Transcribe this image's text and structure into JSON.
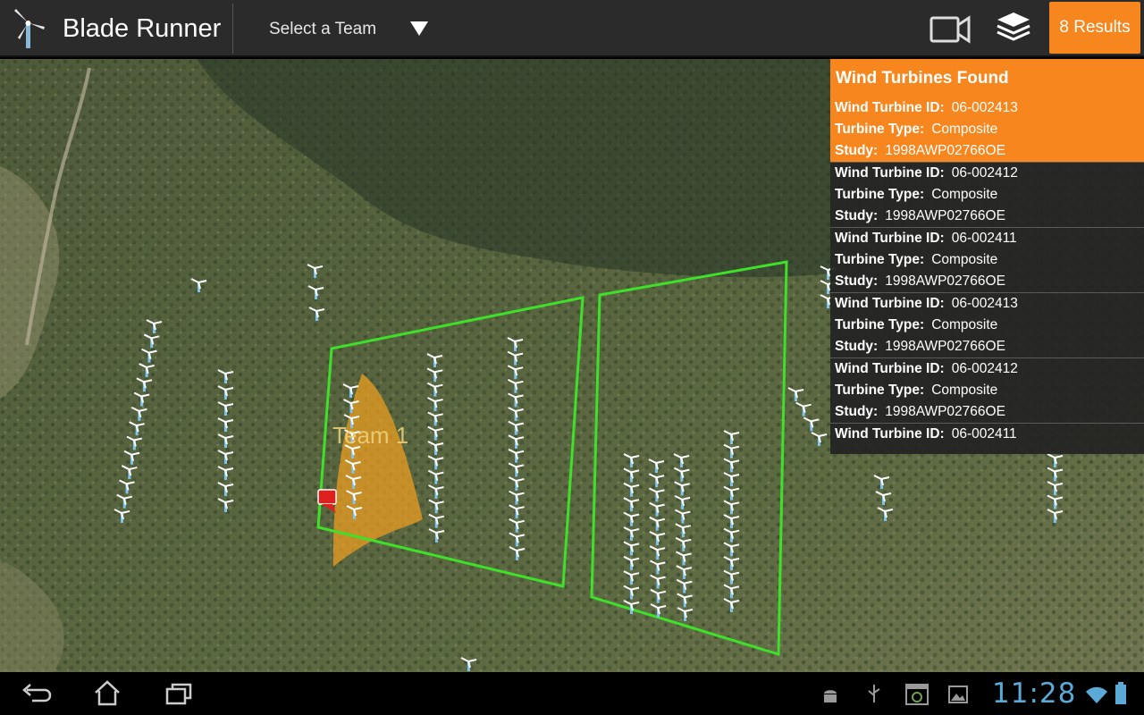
{
  "app": {
    "title": "Blade Runner",
    "icon": "wind-turbine-icon"
  },
  "action_bar": {
    "team_select": {
      "selected": "Select a Team"
    },
    "camera_icon": "video-camera-icon",
    "layers_icon": "layers-icon",
    "results_button": "8 Results"
  },
  "map": {
    "team_label": "Team 1",
    "marker_color": "#e0201c",
    "boundary_color": "#3ee02a",
    "coverage_color": "#f0a020"
  },
  "results_panel": {
    "title": "Wind Turbines Found",
    "labels": {
      "id": "Wind Turbine ID:",
      "type": "Turbine Type:",
      "study": "Study:"
    },
    "items": [
      {
        "id": "06-002413",
        "type": "Composite",
        "study": "1998AWP02766OE",
        "selected": true
      },
      {
        "id": "06-002412",
        "type": "Composite",
        "study": "1998AWP02766OE"
      },
      {
        "id": "06-002411",
        "type": "Composite",
        "study": "1998AWP02766OE"
      },
      {
        "id": "06-002413",
        "type": "Composite",
        "study": "1998AWP02766OE"
      },
      {
        "id": "06-002412",
        "type": "Composite",
        "study": "1998AWP02766OE"
      },
      {
        "id": "06-002411"
      }
    ]
  },
  "system_bar": {
    "time": "11:28",
    "nav": [
      "back-icon",
      "home-icon",
      "recent-apps-icon"
    ],
    "status": [
      "android-debug-icon",
      "usb-icon",
      "screenshot-icon",
      "gallery-icon",
      "wifi-icon",
      "battery-icon"
    ]
  },
  "colors": {
    "accent": "#f7861e",
    "action_bar": "#2b2b2b",
    "clock": "#5aa9d6"
  }
}
